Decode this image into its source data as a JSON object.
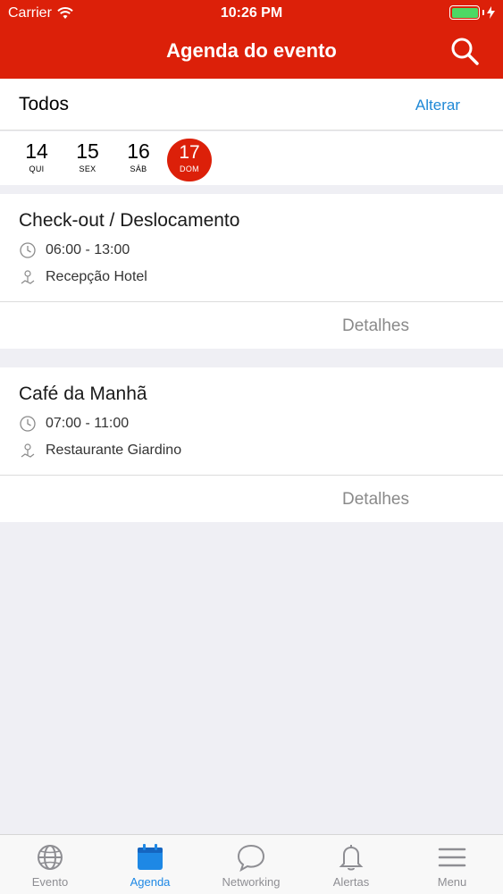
{
  "status_bar": {
    "carrier": "Carrier",
    "time": "10:26 PM"
  },
  "header": {
    "title": "Agenda do evento",
    "search_icon": "search-icon"
  },
  "filter": {
    "label": "Todos",
    "change_label": "Alterar"
  },
  "dates": [
    {
      "day": "14",
      "weekday": "QUI",
      "selected": false
    },
    {
      "day": "15",
      "weekday": "SEX",
      "selected": false
    },
    {
      "day": "16",
      "weekday": "SÁB",
      "selected": false
    },
    {
      "day": "17",
      "weekday": "DOM",
      "selected": true
    }
  ],
  "events": [
    {
      "title": "Check-out / Deslocamento",
      "time": "06:00 - 13:00",
      "location": "Recepção Hotel",
      "details_label": "Detalhes"
    },
    {
      "title": "Café da Manhã",
      "time": "07:00 - 11:00",
      "location": "Restaurante Giardino",
      "details_label": "Detalhes"
    }
  ],
  "tabs": [
    {
      "label": "Evento",
      "icon": "globe-icon",
      "active": false
    },
    {
      "label": "Agenda",
      "icon": "calendar-icon",
      "active": true
    },
    {
      "label": "Networking",
      "icon": "chat-bubble-icon",
      "active": false
    },
    {
      "label": "Alertas",
      "icon": "bell-icon",
      "active": false
    },
    {
      "label": "Menu",
      "icon": "hamburger-menu-icon",
      "active": false
    }
  ],
  "colors": {
    "brand": "#dc2009",
    "accent": "#1e88e5",
    "battery": "#4cd964"
  }
}
